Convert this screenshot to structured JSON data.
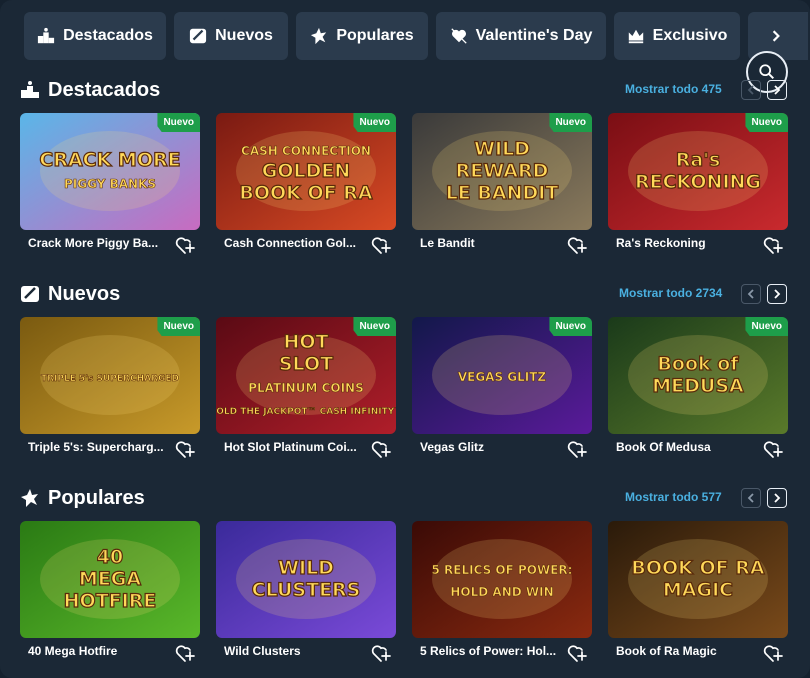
{
  "tabs": [
    {
      "label": "Destacados",
      "icon": "podium-icon"
    },
    {
      "label": "Nuevos",
      "icon": "new-tag-icon"
    },
    {
      "label": "Populares",
      "icon": "star-burst-icon"
    },
    {
      "label": "Valentine's Day",
      "icon": "heart-arrow-icon"
    },
    {
      "label": "Exclusivo",
      "icon": "crown-icon"
    }
  ],
  "sections": [
    {
      "title": "Destacados",
      "icon": "podium-icon",
      "show_all": "Mostrar todo 475",
      "games": [
        {
          "name": "Crack More Piggy Banks",
          "display": "Crack More Piggy Ba...",
          "badge": "Nuevo",
          "art_text": [
            "CRACK MORE",
            "PIGGY BANKS"
          ],
          "colors": [
            "#5ab6e8",
            "#c86bc0"
          ]
        },
        {
          "name": "Cash Connection Golden Book of Ra",
          "display": "Cash Connection Gol...",
          "badge": "Nuevo",
          "art_text": [
            "CASH CONNECTION",
            "GOLDEN",
            "BOOK OF RA"
          ],
          "colors": [
            "#7a1a12",
            "#d84a24"
          ]
        },
        {
          "name": "Le Bandit",
          "display": "Le Bandit",
          "badge": "Nuevo",
          "art_text": [
            "WILD",
            "REWARD",
            "LE BANDIT"
          ],
          "colors": [
            "#3a3a3a",
            "#8a7a5c"
          ]
        },
        {
          "name": "Ra's Reckoning",
          "display": "Ra's Reckoning",
          "badge": "Nuevo",
          "art_text": [
            "Ra's",
            "RECKONING"
          ],
          "colors": [
            "#7a0e14",
            "#c92a2e"
          ]
        }
      ]
    },
    {
      "title": "Nuevos",
      "icon": "new-tag-icon",
      "show_all": "Mostrar todo 2734",
      "games": [
        {
          "name": "Triple 5's: Supercharged",
          "display": "Triple 5's: Supercharg...",
          "badge": "Nuevo",
          "art_text": [
            "TRIPLE 5's SUPERCHARGED"
          ],
          "colors": [
            "#7a5a10",
            "#c89a2a"
          ]
        },
        {
          "name": "Hot Slot Platinum Coins",
          "display": "Hot Slot Platinum Coi...",
          "badge": "Nuevo",
          "art_text": [
            "HOT",
            "SLOT",
            "PLATINUM COINS",
            "HOLD THE JACKPOT™ CASH INFINITY™"
          ],
          "colors": [
            "#5a0a14",
            "#b01e2a"
          ]
        },
        {
          "name": "Vegas Glitz",
          "display": "Vegas Glitz",
          "badge": "Nuevo",
          "art_text": [
            "VEGAS GLITZ"
          ],
          "colors": [
            "#12184a",
            "#5a1a9a"
          ]
        },
        {
          "name": "Book Of Medusa",
          "display": "Book Of Medusa",
          "badge": "Nuevo",
          "art_text": [
            "Book of",
            "MEDUSA"
          ],
          "colors": [
            "#1a3a1a",
            "#5a7a2a"
          ]
        }
      ]
    },
    {
      "title": "Populares",
      "icon": "star-burst-icon",
      "show_all": "Mostrar todo 577",
      "games": [
        {
          "name": "40 Mega Hotfire",
          "display": "40 Mega Hotfire",
          "badge": "",
          "art_text": [
            "40",
            "MEGA",
            "HOTFIRE"
          ],
          "colors": [
            "#2a7a14",
            "#5ab82a"
          ]
        },
        {
          "name": "Wild Clusters",
          "display": "Wild Clusters",
          "badge": "",
          "art_text": [
            "WILD",
            "CLUSTERS"
          ],
          "colors": [
            "#3a2a9a",
            "#7a4ad8"
          ]
        },
        {
          "name": "5 Relics of Power: Hold and Win",
          "display": "5 Relics of Power: Hol...",
          "badge": "",
          "art_text": [
            "5 RELICS OF POWER:",
            "HOLD AND WIN"
          ],
          "colors": [
            "#3a0a06",
            "#8a2a10"
          ]
        },
        {
          "name": "Book of Ra Magic",
          "display": "Book of Ra Magic",
          "badge": "",
          "art_text": [
            "BOOK OF RA",
            "MAGIC"
          ],
          "colors": [
            "#2a1a0a",
            "#7a4a1a"
          ]
        }
      ]
    }
  ],
  "colors": {
    "accent": "#4ab0e0",
    "badge": "#1e9e4a",
    "tab_bg": "#2b3b4d",
    "page_bg": "#1b2836"
  }
}
